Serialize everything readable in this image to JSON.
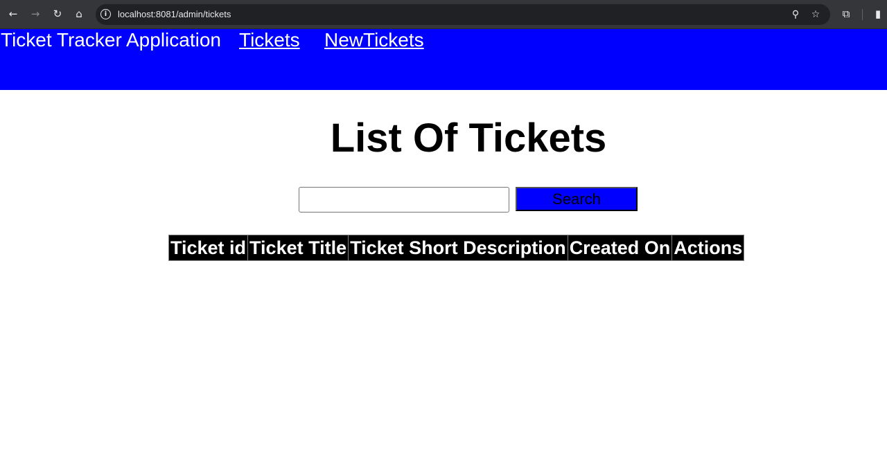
{
  "browser": {
    "url": "localhost:8081/admin/tickets",
    "icons": {
      "back": "arrow-left",
      "forward": "arrow-right",
      "reload": "reload",
      "home": "home",
      "info": "info",
      "zoom": "zoom",
      "bookmark": "star",
      "extensions": "puzzle",
      "sidepanel": "side-panel"
    }
  },
  "header": {
    "brand": "Ticket Tracker Application",
    "links": [
      {
        "label": "Tickets"
      },
      {
        "label": "NewTickets"
      }
    ],
    "background": "#0000ff"
  },
  "main": {
    "title": "List Of Tickets",
    "search": {
      "value": "",
      "placeholder": "",
      "button_label": "Search"
    },
    "table": {
      "columns": [
        "Ticket id",
        "Ticket Title",
        "Ticket Short Description",
        "Created On",
        "Actions"
      ],
      "rows": []
    }
  }
}
